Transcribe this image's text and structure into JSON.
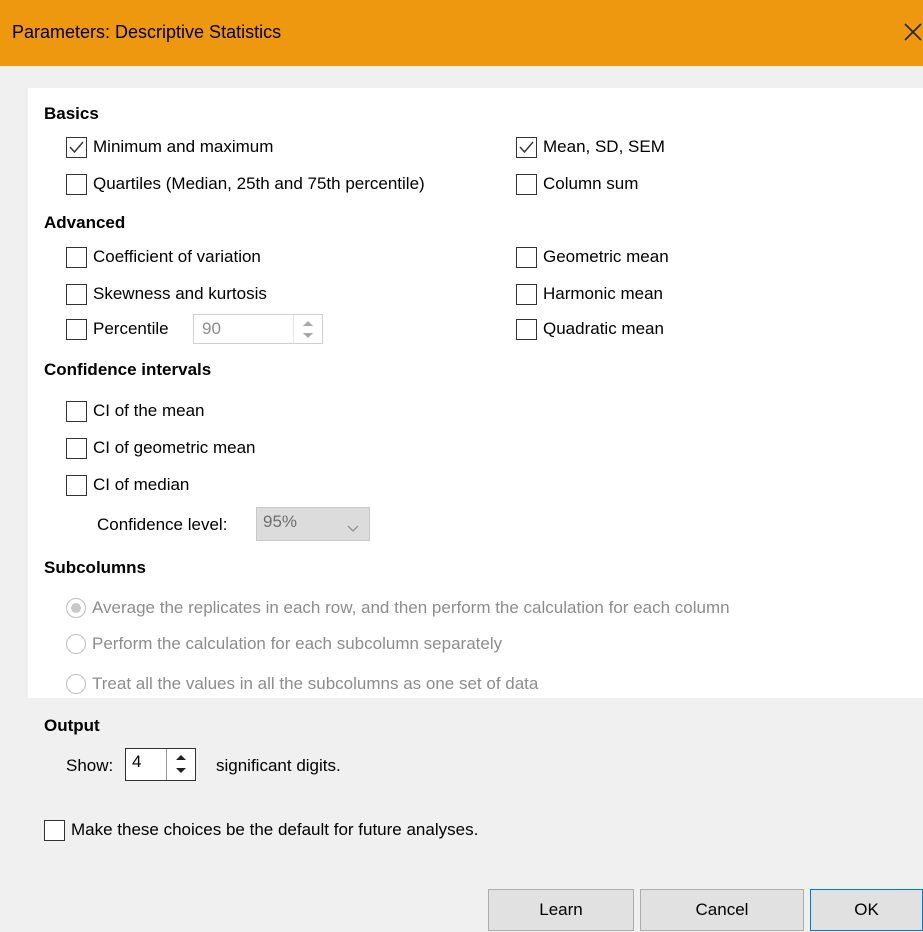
{
  "window": {
    "title": "Parameters: Descriptive Statistics"
  },
  "basics": {
    "heading": "Basics",
    "min_max": {
      "label": "Minimum and maximum",
      "checked": true
    },
    "mean_sd_sem": {
      "label": "Mean, SD, SEM",
      "checked": true
    },
    "quartiles": {
      "label": "Quartiles (Median, 25th and 75th percentile)",
      "checked": false
    },
    "column_sum": {
      "label": "Column sum",
      "checked": false
    }
  },
  "advanced": {
    "heading": "Advanced",
    "coef_variation": {
      "label": "Coefficient of variation",
      "checked": false
    },
    "geometric_mean": {
      "label": "Geometric mean",
      "checked": false
    },
    "skew_kurt": {
      "label": "Skewness and kurtosis",
      "checked": false
    },
    "harmonic_mean": {
      "label": "Harmonic mean",
      "checked": false
    },
    "percentile": {
      "label": "Percentile",
      "checked": false,
      "value": "90"
    },
    "quadratic_mean": {
      "label": "Quadratic mean",
      "checked": false
    }
  },
  "confidence": {
    "heading": "Confidence intervals",
    "ci_mean": {
      "label": "CI of the mean",
      "checked": false
    },
    "ci_geo_mean": {
      "label": "CI of geometric mean",
      "checked": false
    },
    "ci_median": {
      "label": "CI of median",
      "checked": false
    },
    "level_label": "Confidence level:",
    "level_value": "95%"
  },
  "subcolumns": {
    "heading": "Subcolumns",
    "options": [
      {
        "label": "Average the replicates in each row, and then perform the calculation for each column",
        "selected": true
      },
      {
        "label": "Perform the calculation for each subcolumn separately",
        "selected": false
      },
      {
        "label": "Treat all the values in all the subcolumns as one set of data",
        "selected": false
      }
    ]
  },
  "output": {
    "heading": "Output",
    "show_label": "Show:",
    "digits": "4",
    "suffix": "significant digits."
  },
  "default_choice": {
    "label": "Make these choices be the default for future analyses.",
    "checked": false
  },
  "buttons": {
    "learn": "Learn",
    "cancel": "Cancel",
    "ok": "OK"
  },
  "colors": {
    "titlebar": "#ee980f",
    "ok_border": "#0078d7"
  }
}
